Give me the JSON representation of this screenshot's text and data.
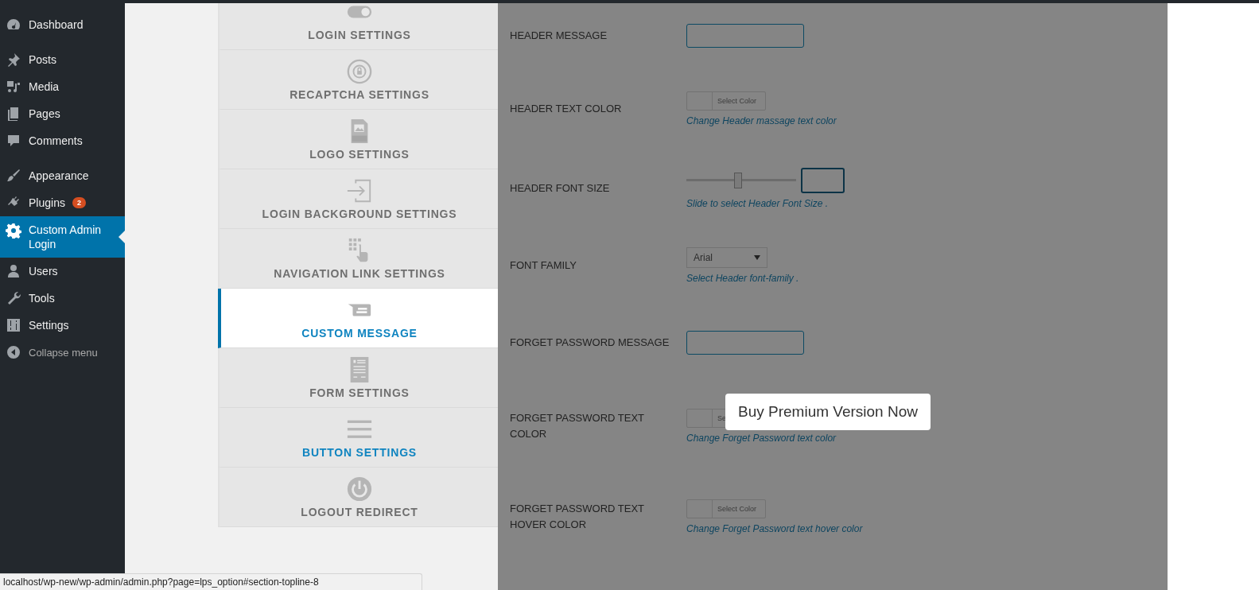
{
  "sidebar": {
    "groups": [
      [
        {
          "label": "Dashboard",
          "selected": false
        }
      ],
      [
        {
          "label": "Posts",
          "selected": false
        },
        {
          "label": "Media",
          "selected": false
        },
        {
          "label": "Pages",
          "selected": false
        },
        {
          "label": "Comments",
          "selected": false
        }
      ],
      [
        {
          "label": "Appearance",
          "selected": false
        },
        {
          "label": "Plugins",
          "selected": false,
          "badge": "2"
        },
        {
          "label": "Custom Admin Login",
          "selected": true
        },
        {
          "label": "Users",
          "selected": false
        },
        {
          "label": "Tools",
          "selected": false
        },
        {
          "label": "Settings",
          "selected": false
        }
      ]
    ],
    "collapse": "Collapse menu"
  },
  "tabs": [
    {
      "label": "LOGIN SETTINGS",
      "selected": false,
      "highlighted": false
    },
    {
      "label": "RECAPTCHA SETTINGS",
      "selected": false,
      "highlighted": false
    },
    {
      "label": "LOGO SETTINGS",
      "selected": false,
      "highlighted": false
    },
    {
      "label": "LOGIN BACKGROUND SETTINGS",
      "selected": false,
      "highlighted": false
    },
    {
      "label": "NAVIGATION LINK SETTINGS",
      "selected": false,
      "highlighted": false
    },
    {
      "label": "CUSTOM MESSAGE",
      "selected": true,
      "highlighted": false
    },
    {
      "label": "FORM SETTINGS",
      "selected": false,
      "highlighted": false
    },
    {
      "label": "BUTTON SETTINGS",
      "selected": false,
      "highlighted": true
    },
    {
      "label": "LOGOUT REDIRECT",
      "selected": false,
      "highlighted": false
    }
  ],
  "fields": [
    {
      "kind": "text",
      "label": "HEADER MESSAGE"
    },
    {
      "kind": "color",
      "label": "HEADER TEXT COLOR",
      "button": "Select Color",
      "description": "Change Header massage text color"
    },
    {
      "kind": "slider",
      "label": "HEADER FONT SIZE",
      "level": 0.47,
      "description": "Slide to select Header Font Size ."
    },
    {
      "kind": "select",
      "label": "FONT FAMILY",
      "value": "Arial",
      "description": "Select Header font-family ."
    },
    {
      "kind": "text",
      "label": "FORGET PASSWORD MESSAGE"
    },
    {
      "kind": "color",
      "label": "FORGET PASSWORD TEXT COLOR",
      "button": "Se",
      "description": "Change Forget Password text color"
    },
    {
      "kind": "color",
      "label": "FORGET PASSWORD TEXT HOVER COLOR",
      "button": "Select Color",
      "description": "Change Forget Password text hover color"
    }
  ],
  "popup": {
    "text": "Buy Premium Version Now"
  },
  "status_bar": {
    "url": "localhost/wp-new/wp-admin/admin.php?page=lps_option#section-topline-8"
  }
}
